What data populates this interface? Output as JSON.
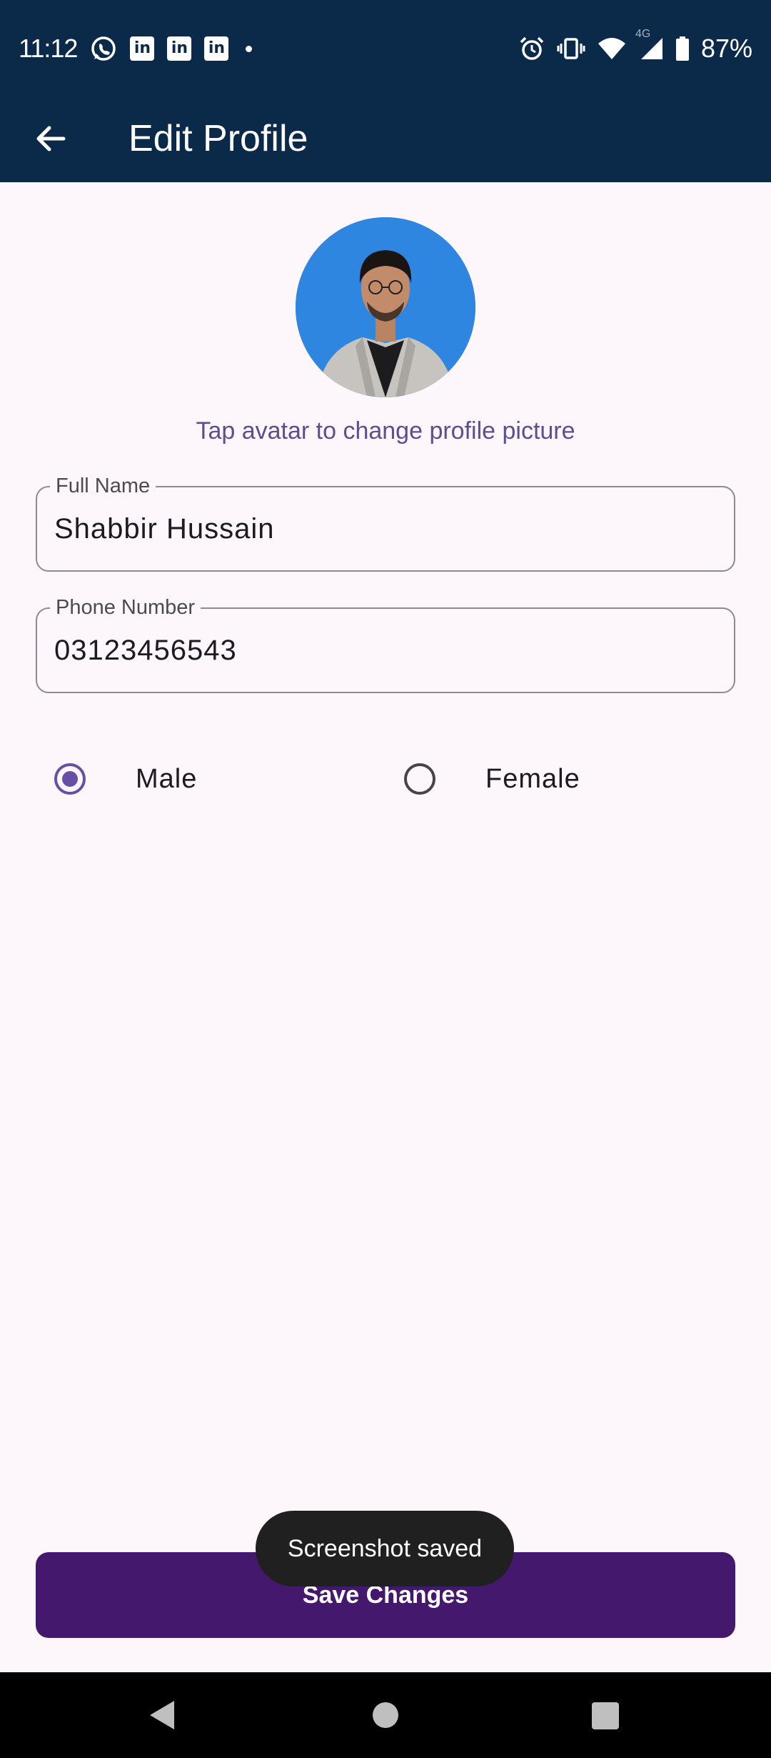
{
  "status_bar": {
    "time": "11:12",
    "battery": "87%",
    "network_type": "4G",
    "notification_icons": [
      "whatsapp-icon",
      "linkedin-icon",
      "linkedin-icon",
      "linkedin-icon"
    ]
  },
  "app_bar": {
    "title": "Edit Profile"
  },
  "avatar": {
    "hint": "Tap avatar to change profile picture"
  },
  "form": {
    "full_name": {
      "label": "Full Name",
      "value": "Shabbir Hussain"
    },
    "phone": {
      "label": "Phone Number",
      "value": "03123456543"
    }
  },
  "gender": {
    "options": [
      {
        "label": "Male",
        "selected": true
      },
      {
        "label": "Female",
        "selected": false
      }
    ]
  },
  "actions": {
    "save_label": "Save Changes"
  },
  "toast": {
    "message": "Screenshot saved"
  },
  "colors": {
    "app_bar": "#0b2a4a",
    "background": "#fdf6fb",
    "accent": "#6750a4",
    "save_button": "#44196d",
    "hint_text": "#5d4e8f"
  }
}
